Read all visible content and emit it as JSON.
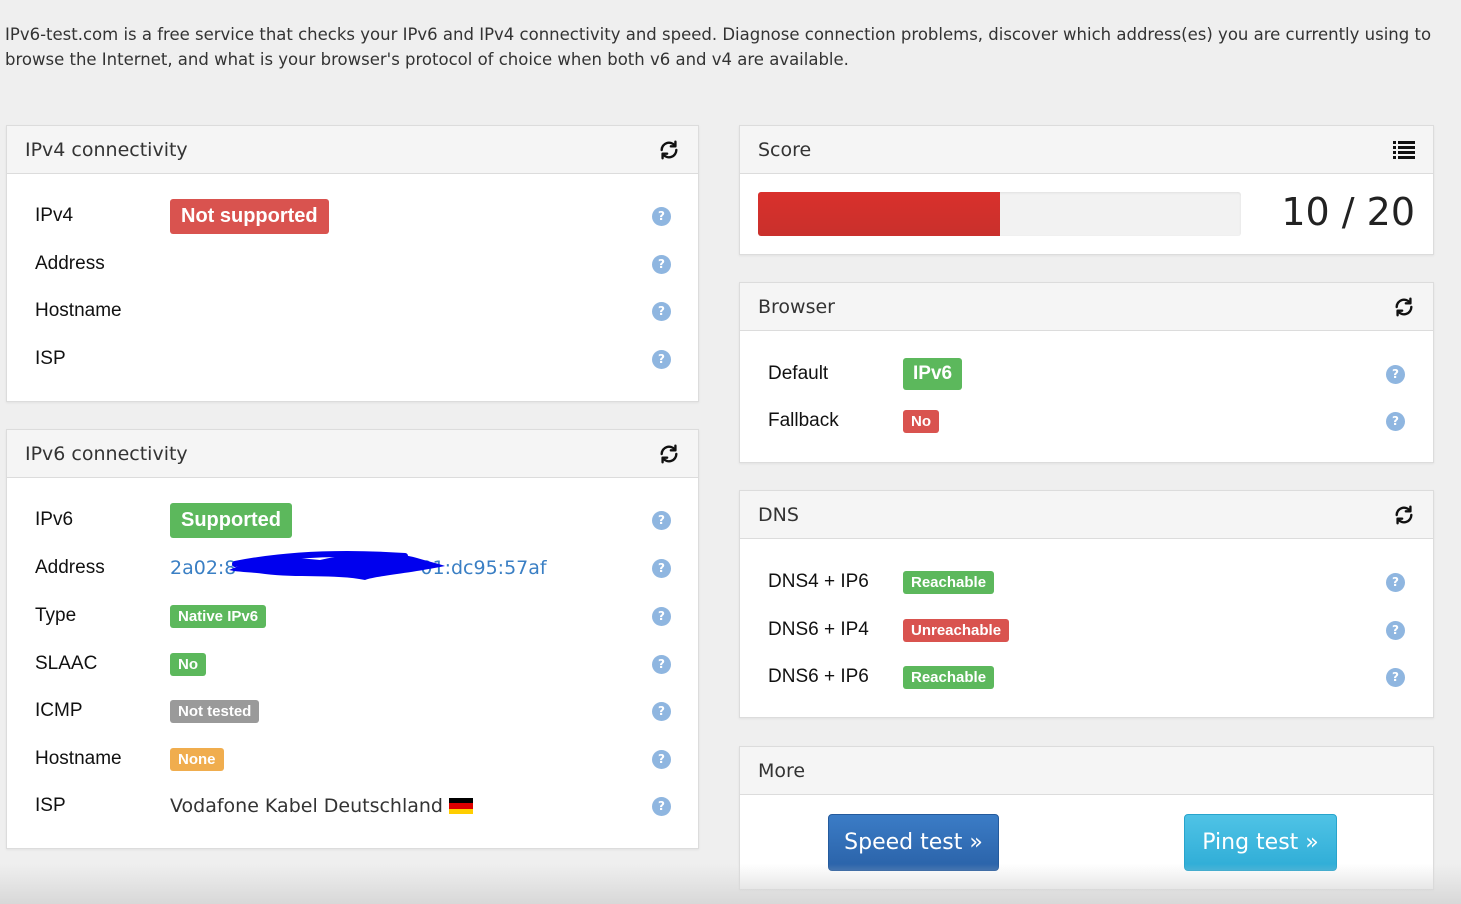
{
  "intro": "IPv6-test.com is a free service that checks your IPv6 and IPv4 connectivity and speed. Diagnose connection problems, discover which address(es) you are currently using to browse the Internet, and what is your browser's protocol of choice when both v6 and v4 are available.",
  "ipv4": {
    "title": "IPv4 connectivity",
    "rows": [
      {
        "label": "IPv4",
        "value": "Not supported"
      },
      {
        "label": "Address",
        "value": ""
      },
      {
        "label": "Hostname",
        "value": ""
      },
      {
        "label": "ISP",
        "value": ""
      }
    ]
  },
  "ipv6": {
    "title": "IPv6 connectivity",
    "rows": [
      {
        "label": "IPv6",
        "value": "Supported"
      },
      {
        "label": "Address",
        "value_start": "2a02:8",
        "value_end": "01:dc95:57af"
      },
      {
        "label": "Type",
        "value": "Native IPv6"
      },
      {
        "label": "SLAAC",
        "value": "No"
      },
      {
        "label": "ICMP",
        "value": "Not tested"
      },
      {
        "label": "Hostname",
        "value": "None"
      },
      {
        "label": "ISP",
        "value": "Vodafone Kabel Deutschland"
      }
    ]
  },
  "score": {
    "title": "Score",
    "value": 10,
    "max": 20,
    "text": "10 / 20"
  },
  "browser": {
    "title": "Browser",
    "rows": [
      {
        "label": "Default",
        "value": "IPv6"
      },
      {
        "label": "Fallback",
        "value": "No"
      }
    ]
  },
  "dns": {
    "title": "DNS",
    "rows": [
      {
        "label": "DNS4 + IP6",
        "value": "Reachable"
      },
      {
        "label": "DNS6 + IP4",
        "value": "Unreachable"
      },
      {
        "label": "DNS6 + IP6",
        "value": "Reachable"
      }
    ]
  },
  "more": {
    "title": "More",
    "speed_test": "Speed test »",
    "ping_test": "Ping test »"
  },
  "colors": {
    "green": "#5cb85c",
    "red": "#d9534f",
    "gray": "#9a9a9a",
    "orange": "#f0ad4e",
    "link": "#3a7fc4",
    "help": "#8fb6e0"
  },
  "icons": {
    "refresh": "refresh-icon",
    "list": "list-icon",
    "help": "help-icon",
    "flag": "germany-flag-icon"
  }
}
